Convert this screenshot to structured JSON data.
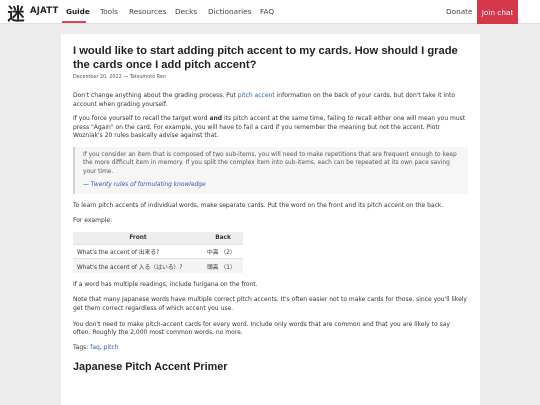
{
  "nav": {
    "logo_glyph": "迷",
    "brand": "AJATT",
    "links": [
      "Guide",
      "Tools",
      "Resources",
      "Decks",
      "Dictionaries",
      "FAQ"
    ],
    "active": "Guide",
    "donate": "Donate",
    "join_chat": "Join chat",
    "accent_color": "#d6384b"
  },
  "article": {
    "title": "I would like to start adding pitch accent to my cards. How should I grade the cards once I add pitch accent?",
    "meta": "December 20, 2022 — Tatsumoto Ren",
    "p1": {
      "before": "Don't change anything about the grading process. Put ",
      "link": "pitch accent",
      "after": " information on the back of your cards, but don't take it into account when grading yourself."
    },
    "p2": {
      "before": "If you force yourself to recall the target word ",
      "bold": "and",
      "after": " its pitch accent at the same time, failing to recall either one will mean you must press \"Again\" on the card. For example, you will have to fail a card if you remember the meaning but not the accent. Piotr Wozniak's 20 rules basically advise against that."
    },
    "quote": {
      "text": "If you consider an item that is composed of two sub-items, you will need to make repetitions that are frequent enough to keep the more difficult item in memory. If you split the complex item into sub-items, each can be repeated at its own pace saving your time.",
      "cite_prefix": "— ",
      "cite_link": "Twenty rules of formulating knowledge"
    },
    "p3": "To learn pitch accents of individual words, make separate cards. Put the word on the front and its pitch accent on the back.",
    "p4": "For example:",
    "table": {
      "headers": [
        "Front",
        "Back"
      ],
      "rows": [
        [
          "What's the accent of 出来る?",
          "中高 （2）"
        ],
        [
          "What's the accent of 入る（はいる）?",
          "頭高 （1）"
        ]
      ]
    },
    "p5": "If a word has multiple readings, include furigana on the front.",
    "p6": "Note that many Japanese words have multiple correct pitch accents. It's often easier not to make cards for those, since you'll likely get them correct regardless of which accent you use.",
    "p7": "You don't need to make pitch-accent cards for every word. Include only words that are common and that you are likely to say often. Roughly the 2,000 most common words, no more.",
    "tags_label": "Tags: ",
    "tags": [
      "faq",
      "pitch"
    ],
    "section_heading": "Japanese Pitch Accent Primer"
  }
}
